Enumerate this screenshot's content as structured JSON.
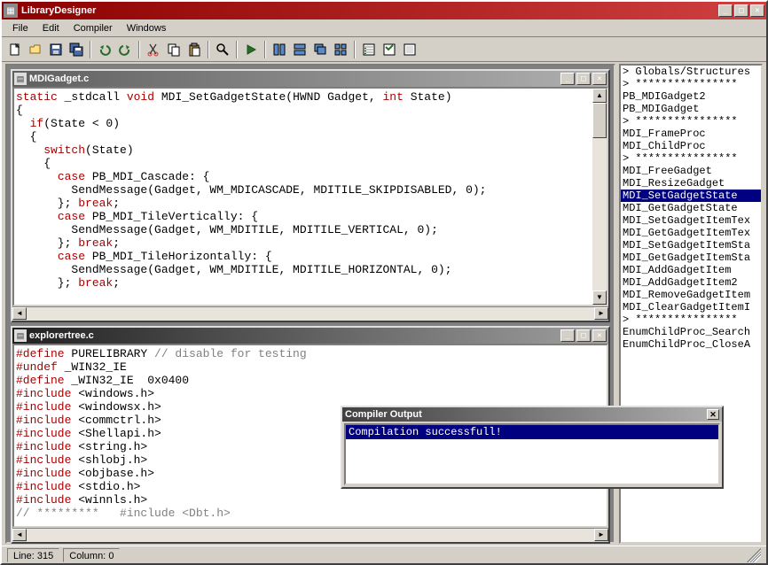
{
  "app": {
    "title": "LibraryDesigner"
  },
  "menu": {
    "items": [
      "File",
      "Edit",
      "Compiler",
      "Windows"
    ]
  },
  "toolbar_icons": [
    "new-file-icon",
    "open-icon",
    "save-icon",
    "save-all-icon",
    "sep",
    "undo-icon",
    "redo-icon",
    "sep",
    "cut-icon",
    "copy-icon",
    "paste-icon",
    "sep",
    "find-icon",
    "sep",
    "run-icon",
    "sep",
    "tile-v-icon",
    "tile-h-icon",
    "cascade-icon",
    "arrange-icon",
    "sep",
    "explorer-icon",
    "options-icon",
    "about-icon"
  ],
  "editors": [
    {
      "filename": "MDIGadget.c",
      "active": false,
      "lines": [
        [
          {
            "t": "static",
            "c": "k-red"
          },
          {
            "t": " _stdcall "
          },
          {
            "t": "void",
            "c": "k-red"
          },
          {
            "t": " MDI_SetGadgetState(HWND Gadget, "
          },
          {
            "t": "int",
            "c": "k-red"
          },
          {
            "t": " State)"
          }
        ],
        [
          {
            "t": "{"
          }
        ],
        [
          {
            "t": "  "
          },
          {
            "t": "if",
            "c": "k-red"
          },
          {
            "t": "(State < 0)"
          }
        ],
        [
          {
            "t": "  {"
          }
        ],
        [
          {
            "t": "    "
          },
          {
            "t": "switch",
            "c": "k-red"
          },
          {
            "t": "(State)"
          }
        ],
        [
          {
            "t": "    {"
          }
        ],
        [
          {
            "t": "      "
          },
          {
            "t": "case",
            "c": "k-red"
          },
          {
            "t": " PB_MDI_Cascade: {"
          }
        ],
        [
          {
            "t": "        SendMessage(Gadget, WM_MDICASCADE, MDITILE_SKIPDISABLED, 0);"
          }
        ],
        [
          {
            "t": "      }; "
          },
          {
            "t": "break",
            "c": "k-red"
          },
          {
            "t": ";"
          }
        ],
        [
          {
            "t": ""
          }
        ],
        [
          {
            "t": "      "
          },
          {
            "t": "case",
            "c": "k-red"
          },
          {
            "t": " PB_MDI_TileVertically: {"
          }
        ],
        [
          {
            "t": "        SendMessage(Gadget, WM_MDITILE, MDITILE_VERTICAL, 0);"
          }
        ],
        [
          {
            "t": "      }; "
          },
          {
            "t": "break",
            "c": "k-red"
          },
          {
            "t": ";"
          }
        ],
        [
          {
            "t": ""
          }
        ],
        [
          {
            "t": "      "
          },
          {
            "t": "case",
            "c": "k-red"
          },
          {
            "t": " PB_MDI_TileHorizontally: {"
          }
        ],
        [
          {
            "t": "        SendMessage(Gadget, WM_MDITILE, MDITILE_HORIZONTAL, 0);"
          }
        ],
        [
          {
            "t": "      }; "
          },
          {
            "t": "break",
            "c": "k-red"
          },
          {
            "t": ";"
          }
        ]
      ]
    },
    {
      "filename": "explorertree.c",
      "active": true,
      "lines": [
        [
          {
            "t": "#define",
            "c": "k-red"
          },
          {
            "t": " PURELIBRARY "
          },
          {
            "t": "// disable for testing",
            "c": "k-grey"
          }
        ],
        [
          {
            "t": ""
          }
        ],
        [
          {
            "t": "#undef",
            "c": "k-red"
          },
          {
            "t": " _WIN32_IE"
          }
        ],
        [
          {
            "t": "#define",
            "c": "k-red"
          },
          {
            "t": " _WIN32_IE  0x0400"
          }
        ],
        [
          {
            "t": ""
          }
        ],
        [
          {
            "t": "#include",
            "c": "k-red"
          },
          {
            "t": " <windows.h>"
          }
        ],
        [
          {
            "t": "#include",
            "c": "k-red"
          },
          {
            "t": " <windowsx.h>"
          }
        ],
        [
          {
            "t": "#include",
            "c": "k-red"
          },
          {
            "t": " <commctrl.h>"
          }
        ],
        [
          {
            "t": "#include",
            "c": "k-red"
          },
          {
            "t": " <Shellapi.h>"
          }
        ],
        [
          {
            "t": "#include",
            "c": "k-red"
          },
          {
            "t": " <string.h>"
          }
        ],
        [
          {
            "t": "#include",
            "c": "k-red"
          },
          {
            "t": " <shlobj.h>"
          }
        ],
        [
          {
            "t": "#include",
            "c": "k-red"
          },
          {
            "t": " <objbase.h>"
          }
        ],
        [
          {
            "t": "#include",
            "c": "k-red"
          },
          {
            "t": " <stdio.h>"
          }
        ],
        [
          {
            "t": "#include",
            "c": "k-red"
          },
          {
            "t": " <winnls.h>"
          }
        ],
        [
          {
            "t": ""
          }
        ],
        [
          {
            "t": "// *********   #include <Dbt.h>",
            "c": "k-grey"
          }
        ]
      ]
    }
  ],
  "sidebar": {
    "items": [
      "> Globals/Structures",
      "> ****************",
      "PB_MDIGadget2",
      "PB_MDIGadget",
      "> ****************",
      "MDI_FrameProc",
      "MDI_ChildProc",
      "> ****************",
      "MDI_FreeGadget",
      "MDI_ResizeGadget",
      "MDI_SetGadgetState",
      "MDI_GetGadgetState",
      "MDI_SetGadgetItemTex",
      "MDI_GetGadgetItemTex",
      "MDI_SetGadgetItemSta",
      "MDI_GetGadgetItemSta",
      "MDI_AddGadgetItem",
      "MDI_AddGadgetItem2",
      "MDI_RemoveGadgetItem",
      "MDI_ClearGadgetItemI",
      "> ****************",
      "EnumChildProc_Search",
      "EnumChildProc_CloseA"
    ],
    "selected_index": 10
  },
  "compiler": {
    "title": "Compiler Output",
    "message": "Compilation successfull!"
  },
  "status": {
    "line_label": "Line:",
    "line": "315",
    "col_label": "Column:",
    "col": "0"
  }
}
